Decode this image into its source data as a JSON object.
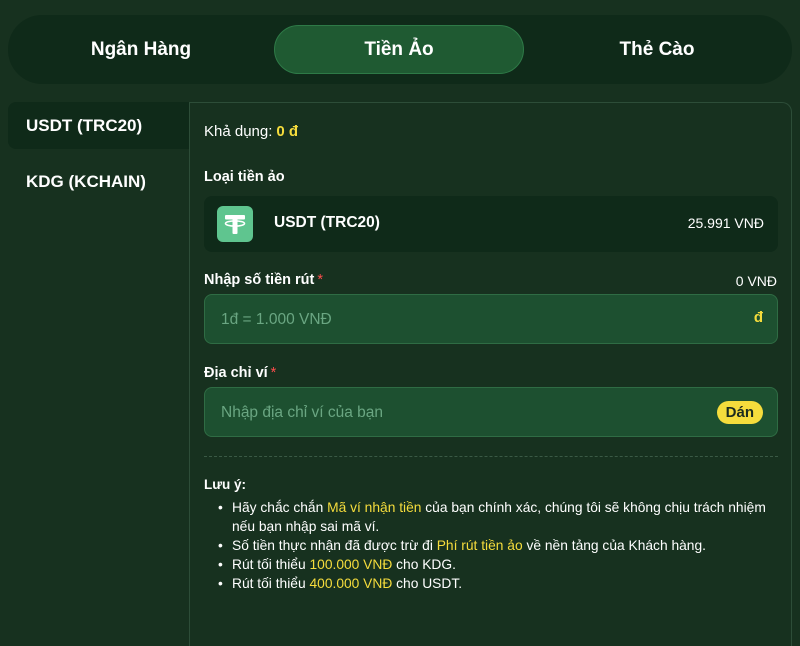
{
  "tabs": [
    {
      "label": "Ngân Hàng",
      "active": false
    },
    {
      "label": "Tiền Ảo",
      "active": true
    },
    {
      "label": "Thẻ Cào",
      "active": false
    }
  ],
  "sidebar": {
    "items": [
      {
        "label": "USDT (TRC20)",
        "active": true
      },
      {
        "label": "KDG (KCHAIN)",
        "active": false
      }
    ]
  },
  "panel": {
    "available_label": "Khả dụng:",
    "available_value": "0 đ",
    "coin_type_label": "Loại tiền ảo",
    "coin": {
      "icon": "tether-icon",
      "name": "USDT (TRC20)",
      "rate": "25.991 VNĐ"
    },
    "amount": {
      "label": "Nhập số tiền rút",
      "required_mark": "*",
      "converted": "0 VNĐ",
      "placeholder": "1đ = 1.000 VNĐ",
      "value": "",
      "suffix": "đ"
    },
    "wallet": {
      "label": "Địa chỉ ví",
      "required_mark": "*",
      "placeholder": "Nhập địa chỉ ví của bạn",
      "value": "",
      "paste_label": "Dán"
    },
    "notes": {
      "title": "Lưu ý:",
      "bullet": "•",
      "items": [
        {
          "before": "Hãy chắc chắn ",
          "highlight": "Mã ví nhận tiền",
          "after": " của bạn chính xác, chúng tôi sẽ không chịu trách nhiệm nếu bạn nhập sai mã ví."
        },
        {
          "before": "Số tiền thực nhận đã được trừ đi ",
          "highlight": "Phí rút tiền ảo",
          "after": " về nền tảng của Khách hàng."
        },
        {
          "before": "Rút tối thiểu ",
          "highlight": "100.000 VNĐ",
          "after": " cho KDG."
        },
        {
          "before": "Rút tối thiểu ",
          "highlight": "400.000 VNĐ",
          "after": " cho USDT."
        }
      ]
    }
  },
  "colors": {
    "background": "#17311f",
    "dark_surface": "#0f2a19",
    "input_bg": "#1d5030",
    "accent_yellow": "#f5dc3c",
    "required_red": "#ff4d4d",
    "tether_green": "#5fc58f"
  }
}
